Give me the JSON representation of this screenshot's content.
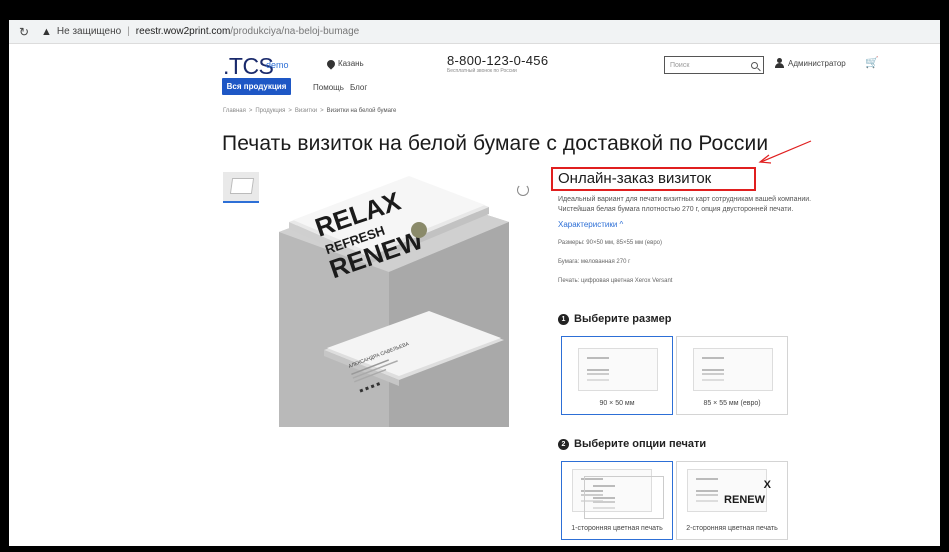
{
  "browser": {
    "reload_icon": "reload-icon",
    "insecure_label": "Не защищено",
    "host": "reestr.wow2print.com",
    "path": "/produkciya/na-beloj-bumage"
  },
  "header": {
    "logo": ".TCS",
    "logo_suffix": "demo",
    "city": "Казань",
    "phone": "8-800-123-0-456",
    "phone_note": "Бесплатный звонок по России",
    "search_placeholder": "Поиск",
    "user": "Администратор"
  },
  "nav": {
    "primary": "Вся продукция",
    "links": [
      "Помощь",
      "Блог"
    ]
  },
  "breadcrumb": [
    "Главная",
    "Продукция",
    "Визитки",
    "Визитки на белой бумаге"
  ],
  "page_title": "Печать визиток на белой бумаге с доставкой по России",
  "gallery": {
    "art_line1": "RELAX",
    "art_line2": "REFRESH",
    "art_line3": "RENEW",
    "name_card": "АЛЕКСАНДРА САВЕЛЬЕВА"
  },
  "product": {
    "title": "Онлайн-заказ визиток",
    "description": "Идеальный вариант для печати визитных карт сотрудникам вашей компании. Чистейшая белая бумага плотностью 270 г, опция двусторонней печати.",
    "characteristics_link": "Характеристики ^",
    "specs": [
      "Размеры: 90×50 мм, 85×55 мм (евро)",
      "Бумага: мелованная 270 г",
      "Печать: цифровая цветная Xerox Versant"
    ]
  },
  "size_step": {
    "num": "1",
    "title": "Выберите размер",
    "options": [
      "90 × 50 мм",
      "85 × 55 мм (евро)"
    ]
  },
  "print_step": {
    "num": "2",
    "title": "Выберите опции печати",
    "options": [
      "1-сторонняя цветная печать",
      "2-сторонняя цветная печать"
    ],
    "preview_x": "X",
    "preview_renew": "RENEW"
  },
  "colors": {
    "accent": "#1e57c5",
    "highlight": "#e01f1f"
  }
}
